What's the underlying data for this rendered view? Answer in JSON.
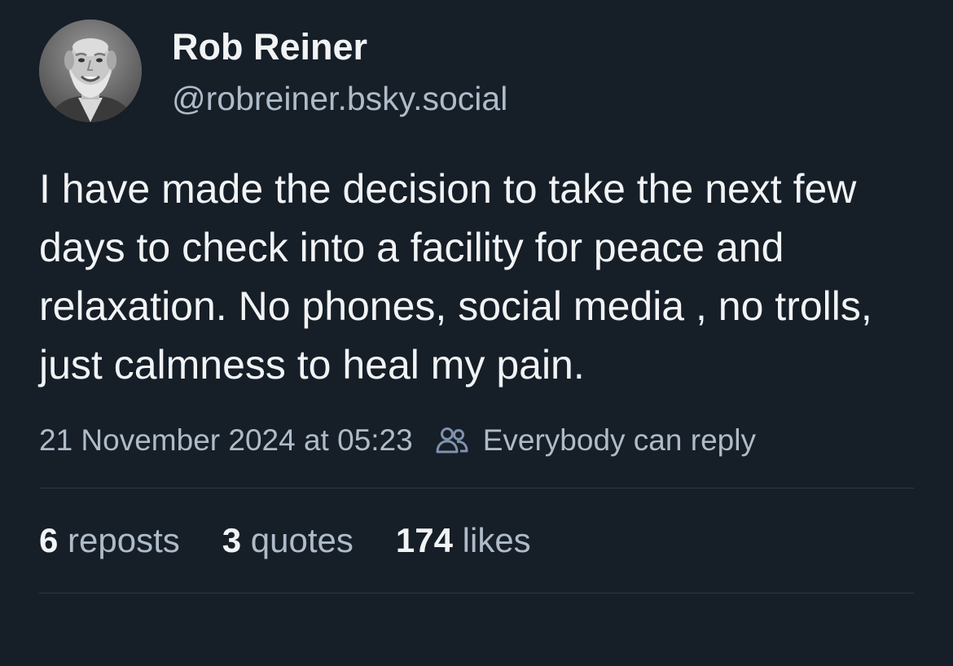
{
  "author": {
    "display_name": "Rob Reiner",
    "handle": "@robreiner.bsky.social",
    "avatar_icon": "user-avatar-photo"
  },
  "post": {
    "text": "I have made the decision to take the next few days to check into a facility for peace and relaxation. No phones, social media , no trolls, just calmness to heal my pain.",
    "timestamp": "21 November 2024 at 05:23",
    "reply_setting": "Everybody can reply",
    "reply_setting_icon": "people-icon"
  },
  "stats": {
    "reposts": {
      "count": "6",
      "label": "reposts"
    },
    "quotes": {
      "count": "3",
      "label": "quotes"
    },
    "likes": {
      "count": "174",
      "label": "likes"
    }
  },
  "colors": {
    "background": "#161e27",
    "primary_text": "#f1f3f5",
    "secondary_text": "#aebbc9",
    "icon_accent": "#7e92ad",
    "divider": "#2e3946"
  }
}
